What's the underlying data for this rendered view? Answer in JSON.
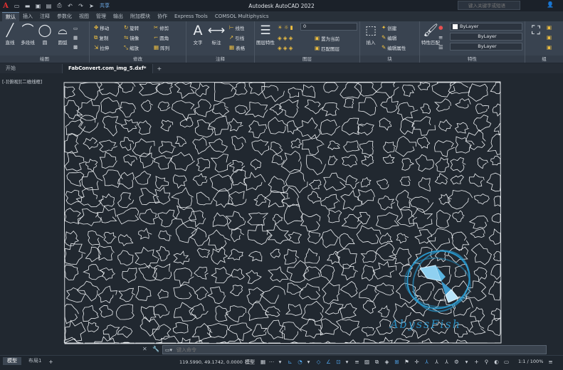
{
  "title_bar": {
    "app_logo": "A",
    "app_title": "Autodesk AutoCAD 2022",
    "share_label": "共享",
    "search_placeholder": "键入关键字或短语",
    "quick_access_icons": [
      "new-icon",
      "open-icon",
      "save-icon",
      "saveas-icon",
      "plot-icon",
      "undo-icon",
      "redo-icon",
      "share-icon"
    ]
  },
  "ribbon_tabs": [
    "默认",
    "插入",
    "注释",
    "参数化",
    "视图",
    "管理",
    "输出",
    "附加模块",
    "协作",
    "Express Tools",
    "COMSOL Multiphysics"
  ],
  "active_ribbon_tab": "默认",
  "panels": {
    "draw": {
      "title": "绘图",
      "line": "直线",
      "polyline": "多段线",
      "circle": "圆",
      "arc": "圆弧"
    },
    "modify": {
      "title": "修改",
      "move": "移动",
      "rotate": "旋转",
      "trim": "修剪",
      "copy": "复制",
      "mirror": "镜像",
      "fillet": "圆角",
      "stretch": "拉伸",
      "scale": "缩放",
      "array": "阵列"
    },
    "annotation": {
      "title": "注释",
      "text": "文字",
      "dimension": "标注",
      "linear": "线性",
      "leader": "引线",
      "table": "表格"
    },
    "layers": {
      "title": "图层",
      "layer_properties": "图层特性",
      "current_layer": "0",
      "make_current": "置为当前",
      "match_layer": "匹配图层"
    },
    "block": {
      "title": "块",
      "insert": "插入",
      "create": "创建",
      "edit": "编辑",
      "edit_attributes": "编辑属性"
    },
    "properties": {
      "title": "特性",
      "match_properties": "特性匹配",
      "color": "ByLayer",
      "linetype": "ByLayer",
      "lineweight": "ByLayer"
    },
    "groups": {
      "title": "组"
    }
  },
  "file_tabs": [
    "开始",
    "FabConvert.com_img_5.dxf*"
  ],
  "active_file_tab": "FabConvert.com_img_5.dxf*",
  "viewport_label": "[-][俯视][二维线框]",
  "watermark_text": "AbyssFish",
  "command_line": {
    "placeholder": "键入命令"
  },
  "status_bar": {
    "layout_tabs": [
      "模型",
      "布局1"
    ],
    "active_layout": "模型",
    "coordinates": "119.5990, 49.1742, 0.0000",
    "model_label": "模型",
    "scale": "1:1 / 100%"
  }
}
